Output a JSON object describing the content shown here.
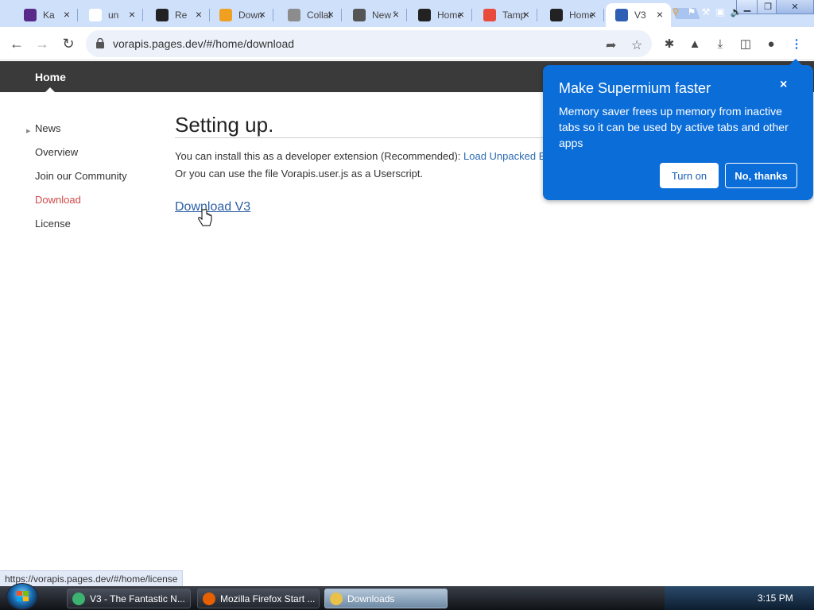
{
  "browser": {
    "tabs": [
      {
        "title": "Ka",
        "icon": "kahoot-favicon",
        "color": "#5a2a8a"
      },
      {
        "title": "un",
        "icon": "google-favicon",
        "color": "#ffffff"
      },
      {
        "title": "Re",
        "icon": "github-favicon",
        "color": "#222222"
      },
      {
        "title": "Downlo",
        "icon": "orange-favicon",
        "color": "#f0a020"
      },
      {
        "title": "Collab",
        "icon": "collab-favicon",
        "color": "#8c8c8c"
      },
      {
        "title": "New Ta",
        "icon": "globe-favicon",
        "color": "#555555"
      },
      {
        "title": "Home |",
        "icon": "discord-favicon",
        "color": "#222222"
      },
      {
        "title": "Tamper",
        "icon": "tampermonkey-favicon",
        "color": "#e84a3c"
      },
      {
        "title": "Home |",
        "icon": "discord-favicon",
        "color": "#222222"
      },
      {
        "title": "V3",
        "icon": "google-favicon",
        "color": "#2f5fb5",
        "active": true
      }
    ],
    "close_glyph": "×",
    "window_controls": {
      "minimize": "▁",
      "maximize": "❐",
      "close": "✕"
    },
    "url": "vorapis.pages.dev/#/home/download"
  },
  "site": {
    "header_home": "Home",
    "nav": [
      "News",
      "Overview",
      "Join our Community",
      "Download",
      "License"
    ],
    "nav_active_index": 3,
    "heading": "Setting up.",
    "para1_text": "You can install this as a developer extension (Recommended): ",
    "para1_link": "Load Unpacked E",
    "para2_text": "Or you can use the file Vorapis.user.js as a Userscript.",
    "download_link": "Download V3"
  },
  "popup": {
    "title": "Make Supermium faster",
    "body": "Memory saver frees up memory from inactive tabs so it can be used by active tabs and other apps",
    "turn_on": "Turn on",
    "no_thanks": "No, thanks",
    "close": "×"
  },
  "status_url": "https://vorapis.pages.dev/#/home/license",
  "taskbar": {
    "buttons": [
      {
        "label": "V3 - The Fantastic N...",
        "icon_color": "#3cb371"
      },
      {
        "label": "Mozilla Firefox Start ...",
        "icon_color": "#e66000"
      },
      {
        "label": "Downloads",
        "icon_color": "#e8c14a",
        "active": true
      }
    ],
    "clock": "3:15 PM"
  },
  "colors": {
    "accent_blue": "#0b6dd8",
    "nav_active": "#d04a4a",
    "header_bg": "#3a3a3a"
  }
}
